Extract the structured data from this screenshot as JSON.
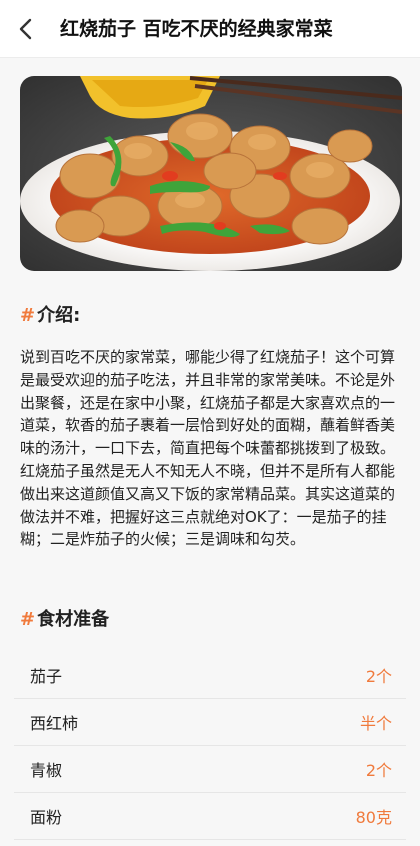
{
  "header": {
    "title": "红烧茄子 百吃不厌的经典家常菜",
    "back_icon": "chevron-left-icon"
  },
  "hero": {
    "image": "braised-eggplant-dish-photo"
  },
  "intro": {
    "heading_hash": "#",
    "heading": "介绍:",
    "paragraphs": [
      "说到百吃不厌的家常菜，哪能少得了红烧茄子！这个可算是最受欢迎的茄子吃法，并且非常的家常美味。不论是外出聚餐，还是在家中小聚，红烧茄子都是大家喜欢点的一道菜，软香的茄子裹着一层恰到好处的面糊，蘸着鲜香美味的汤汁，一口下去，简直把每个味蕾都挑拨到了极致。",
      "红烧茄子虽然是无人不知无人不晓，但并不是所有人都能做出来这道颜值又高又下饭的家常精品菜。其实这道菜的做法并不难，把握好这三点就绝对OK了：一是茄子的挂糊；二是炸茄子的火候；三是调味和勾芡。"
    ]
  },
  "ingredients": {
    "heading_hash": "#",
    "heading": "食材准备",
    "items": [
      {
        "name": "茄子",
        "qty": "2个"
      },
      {
        "name": "西红柿",
        "qty": "半个"
      },
      {
        "name": "青椒",
        "qty": "2个"
      },
      {
        "name": "面粉",
        "qty": "80克"
      }
    ]
  },
  "colors": {
    "accent": "#f07a3c",
    "text": "#222222",
    "background": "#f7f7f7"
  }
}
